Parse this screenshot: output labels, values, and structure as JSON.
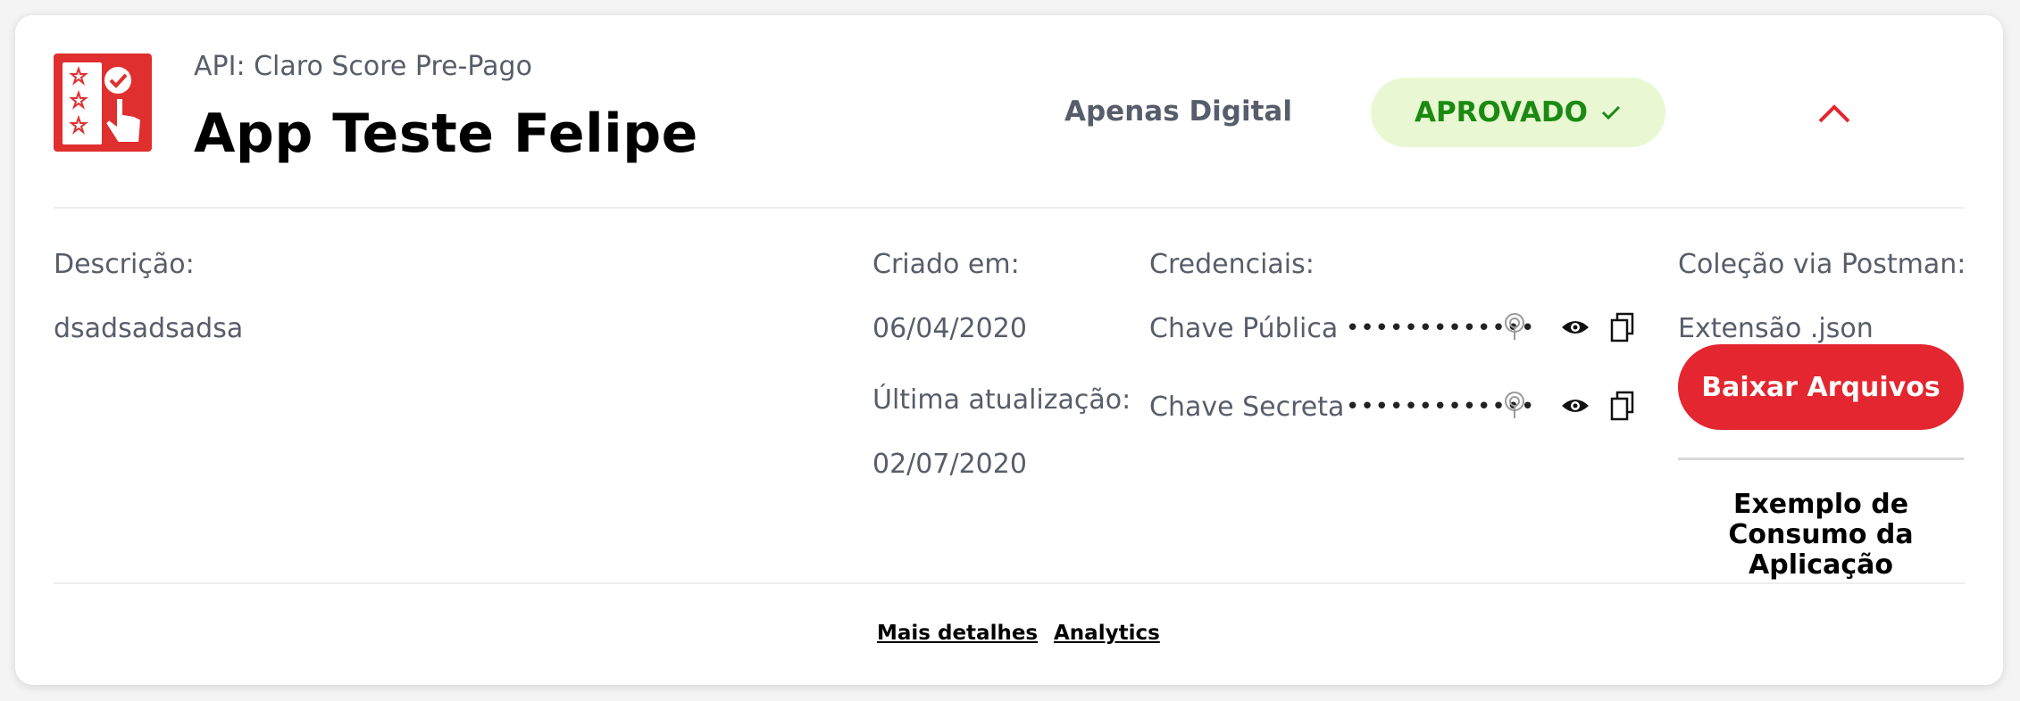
{
  "header": {
    "api_label": "API: Claro Score Pre-Pago",
    "app_name": "App Teste Felipe",
    "channel": "Apenas Digital",
    "status": "APROVADO"
  },
  "description": {
    "label": "Descrição:",
    "value": "dsadsadsadsa"
  },
  "dates": {
    "created_label": "Criado em:",
    "created_value": "06/04/2020",
    "updated_label": "Última atualização:",
    "updated_value": "02/07/2020"
  },
  "credentials": {
    "label": "Credenciais:",
    "public_key_label": "Chave Pública",
    "public_key_value": "•••••••••••••",
    "secret_key_label": "Chave Secreta",
    "secret_key_value": "•••••••••••••"
  },
  "postman": {
    "label": "Coleção via Postman:",
    "extension": "Extensão .json",
    "download_button": "Baixar Arquivos",
    "example_link": "Exemplo de Consumo da Aplicação"
  },
  "footer": {
    "more_details": "Mais detalhes",
    "analytics": "Analytics"
  },
  "colors": {
    "primary_red": "#e3262f",
    "approved_bg": "#e9f8d2",
    "approved_text": "#1b8a13"
  },
  "icons": [
    "app-rating-icon",
    "checkmark-icon",
    "chevron-up-icon",
    "fingerprint-icon",
    "eye-icon",
    "copy-icon"
  ]
}
